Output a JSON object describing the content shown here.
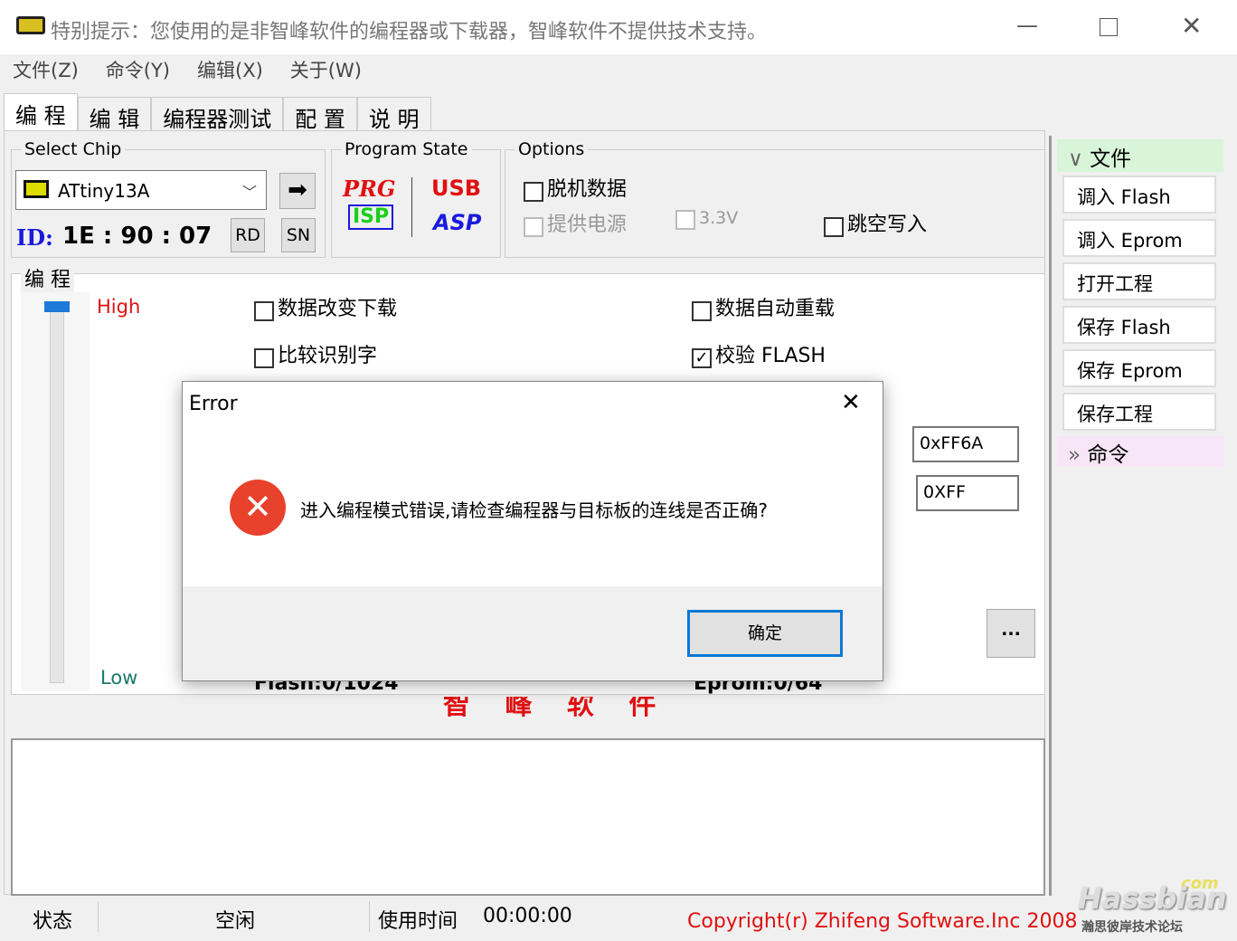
{
  "window": {
    "title": "特别提示：您使用的是非智峰软件的编程器或下载器，智峰软件不提供技术支持。"
  },
  "menu": [
    "文件(Z)",
    "命令(Y)",
    "编辑(X)",
    "关于(W)"
  ],
  "tabs": [
    "编 程",
    "编 辑",
    "编程器测试",
    "配 置",
    "说 明"
  ],
  "select_chip": {
    "label": "Select Chip",
    "value": "ATtiny13A",
    "id_label": "ID:",
    "id_value": "1E : 90 : 07",
    "rd": "RD",
    "sn": "SN"
  },
  "program_state": {
    "label": "Program State",
    "prg": "PRG",
    "isp": "ISP",
    "usb": "USB",
    "asp": "ASP"
  },
  "options": {
    "label": "Options",
    "offline": "脱机数据",
    "power": "提供电源",
    "v33": "3.3V",
    "skip": "跳空写入"
  },
  "program": {
    "label": "编 程",
    "high": "High",
    "low": "Low",
    "opt1": "数据改变下载",
    "opt2": "数据自动重载",
    "opt3": "比较识别字",
    "opt4": "校验 FLASH",
    "opt4_checked": true,
    "field1": "0xFF6A",
    "field2": "0XFF",
    "more": "...",
    "flash": "Flash:0/1024",
    "eprom": "Eprom:0/64",
    "brand": "智 峰 软 件"
  },
  "sidebar": {
    "file_header": "文件",
    "items": [
      "调入 Flash",
      "调入 Eprom",
      "打开工程",
      "保存 Flash",
      "保存 Eprom",
      "保存工程"
    ],
    "cmd_header": "命令"
  },
  "status": {
    "label": "状态",
    "value": "空闲",
    "time_label": "使用时间",
    "time": "00:00:00",
    "copyright": "Copyright(r) Zhifeng Software.Inc 2008"
  },
  "watermark": {
    "text": "Hassbian",
    "com": "com",
    "sub": "瀚思彼岸技术论坛"
  },
  "dialog": {
    "title": "Error",
    "message": "进入编程模式错误,请检查编程器与目标板的连线是否正确?",
    "ok": "确定"
  }
}
